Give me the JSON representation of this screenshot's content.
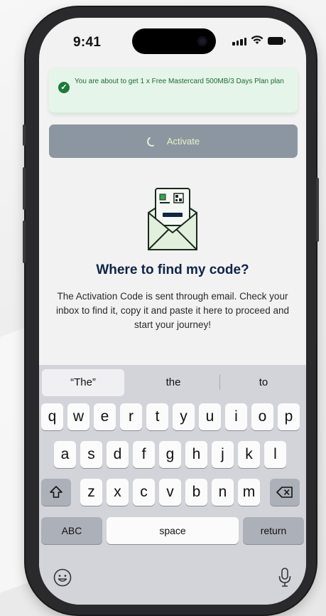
{
  "status_bar": {
    "time": "9:41"
  },
  "toast": {
    "message": "You are about to get 1 x Free Mastercard 500MB/3 Days Plan plan"
  },
  "activate_button": {
    "label": "Activate"
  },
  "info": {
    "heading": "Where to find my code?",
    "body": "The Activation Code is sent through email. Check your inbox to find it, copy it and paste it here to proceed and start your journey!"
  },
  "keyboard": {
    "predictions": [
      "“The”",
      "the",
      "to"
    ],
    "row1": [
      "q",
      "w",
      "e",
      "r",
      "t",
      "y",
      "u",
      "i",
      "o",
      "p"
    ],
    "row2": [
      "a",
      "s",
      "d",
      "f",
      "g",
      "h",
      "j",
      "k",
      "l"
    ],
    "row3": [
      "z",
      "x",
      "c",
      "v",
      "b",
      "n",
      "m"
    ],
    "abc_label": "ABC",
    "space_label": "space",
    "return_label": "return"
  },
  "icons": {
    "success": "check-circle-icon",
    "shift": "shift-icon",
    "delete": "backspace-icon",
    "emoji": "emoji-icon",
    "mic": "microphone-icon",
    "envelope": "envelope-card-icon"
  },
  "colors": {
    "toast_bg": "#e6f5e9",
    "toast_text": "#1e6a34",
    "button_bg": "#8c96a1",
    "heading": "#0f2447"
  }
}
